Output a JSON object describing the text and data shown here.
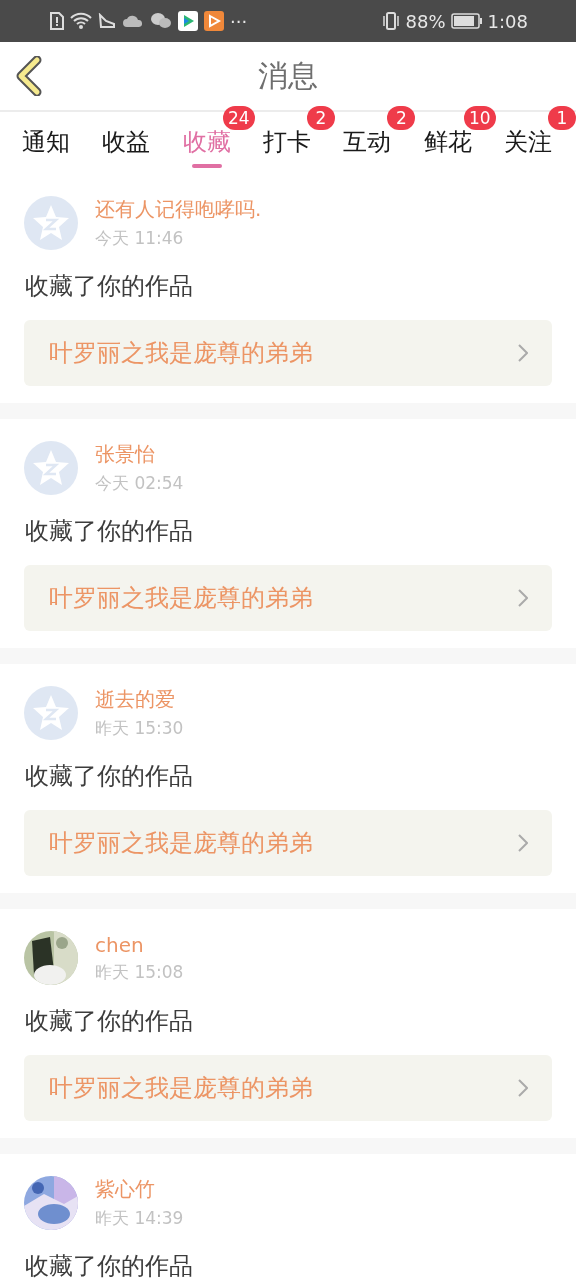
{
  "status_bar": {
    "more": "···",
    "battery_percent": "88%",
    "time": "1:08"
  },
  "header": {
    "title": "消息"
  },
  "tabs": [
    {
      "label": "通知",
      "selected": false
    },
    {
      "label": "收益",
      "selected": false
    },
    {
      "label": "收藏",
      "selected": true,
      "badge": "24"
    },
    {
      "label": "打卡",
      "selected": false,
      "badge": "2"
    },
    {
      "label": "互动",
      "selected": false,
      "badge": "2"
    },
    {
      "label": "鲜花",
      "selected": false,
      "badge": "10"
    },
    {
      "label": "关注",
      "selected": false,
      "badge": "1"
    }
  ],
  "messages": [
    {
      "avatar": {
        "kind": "default"
      },
      "name": "还有人记得咆哮吗.",
      "time": "今天 11:46",
      "action": "收藏了你的作品",
      "work": "叶罗丽之我是庞尊的弟弟"
    },
    {
      "avatar": {
        "kind": "default"
      },
      "name": "张景怡",
      "time": "今天 02:54",
      "action": "收藏了你的作品",
      "work": "叶罗丽之我是庞尊的弟弟"
    },
    {
      "avatar": {
        "kind": "default"
      },
      "name": "逝去的爱",
      "time": "昨天 15:30",
      "action": "收藏了你的作品",
      "work": "叶罗丽之我是庞尊的弟弟"
    },
    {
      "name": "chen",
      "time": "昨天 15:08",
      "action": "收藏了你的作品",
      "work": "叶罗丽之我是庞尊的弟弟"
    },
    {
      "name": "紫心竹",
      "time": "昨天 14:39",
      "action": "收藏了你的作品"
    }
  ]
}
